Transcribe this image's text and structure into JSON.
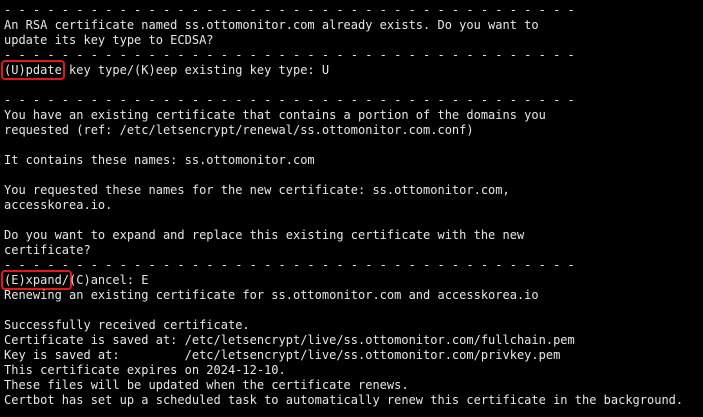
{
  "terminal": {
    "lines": [
      "- - - - - - - - - - - - - - - - - - - - - - - - - - - - - - - - - - - - - - - -",
      "An RSA certificate named ss.ottomonitor.com already exists. Do you want to",
      "update its key type to ECDSA?",
      "- - - - - - - - - - - - - - - - - - - - - - - - - - - - - - - - - - - - - - - -",
      "",
      "",
      "- - - - - - - - - - - - - - - - - - - - - - - - - - - - - - - - - - - - - - - -",
      "You have an existing certificate that contains a portion of the domains you",
      "requested (ref: /etc/letsencrypt/renewal/ss.ottomonitor.com.conf)",
      "",
      "It contains these names: ss.ottomonitor.com",
      "",
      "You requested these names for the new certificate: ss.ottomonitor.com,",
      "accesskorea.io.",
      "",
      "Do you want to expand and replace this existing certificate with the new",
      "certificate?",
      "- - - - - - - - - - - - - - - - - - - - - - - - - - - - - - - - - - - - - - - -",
      "",
      "Renewing an existing certificate for ss.ottomonitor.com and accesskorea.io",
      "",
      "Successfully received certificate.",
      "Certificate is saved at: /etc/letsencrypt/live/ss.ottomonitor.com/fullchain.pem",
      "Key is saved at:         /etc/letsencrypt/live/ss.ottomonitor.com/privkey.pem",
      "This certificate expires on 2024-12-10.",
      "These files will be updated when the certificate renews.",
      "Certbot has set up a scheduled task to automatically renew this certificate in the background."
    ],
    "prompt_update": {
      "highlight": "(U)pdate",
      "rest": " key type/(K)eep existing key type: U"
    },
    "prompt_expand": {
      "highlight": "(E)xpand/",
      "rest": "(C)ancel: E"
    },
    "highlight_color": "#e01818",
    "text_color": "#e6e6e6",
    "background_color": "#000000"
  }
}
